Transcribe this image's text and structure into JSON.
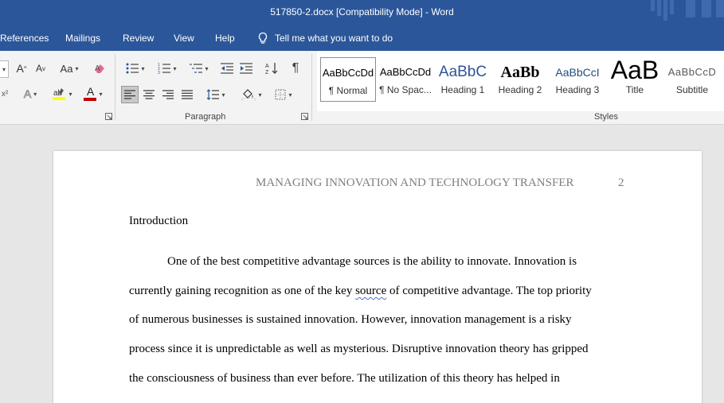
{
  "window": {
    "title": "517850-2.docx [Compatibility Mode]  -  Word"
  },
  "tabs": [
    "References",
    "Mailings",
    "Review",
    "View",
    "Help"
  ],
  "tell_me": {
    "placeholder": "Tell me what you want to do",
    "icon": "lightbulb-icon"
  },
  "ribbon": {
    "groups": {
      "paragraph": "Paragraph",
      "styles": "Styles"
    },
    "font_buttons": {
      "grow_font": "A",
      "shrink_font": "A",
      "change_case": "Aa",
      "text_effects": "A",
      "font_color": "A"
    },
    "colors": {
      "highlight": "#ffff00",
      "font_color": "#c00000",
      "clear_format": "#e06c8c"
    }
  },
  "styles": [
    {
      "sample": "AaBbCcDd",
      "name": "¶ Normal",
      "selected": true
    },
    {
      "sample": "AaBbCcDd",
      "name": "¶ No Spac..."
    },
    {
      "sample": "AaBbC",
      "name": "Heading 1"
    },
    {
      "sample": "AaBb",
      "name": "Heading 2"
    },
    {
      "sample": "AaBbCcI",
      "name": "Heading 3"
    },
    {
      "sample": "AaB",
      "name": "Title"
    },
    {
      "sample": "AaBbCcD",
      "name": "Subtitle"
    }
  ],
  "document": {
    "header": {
      "running_head": "MANAGING INNOVATION AND TECHNOLOGY TRANSFER",
      "page_number": "2"
    },
    "heading": "Introduction",
    "lines": [
      {
        "before": "One of the best competitive advantage sources is the ability to innovate. Innovation is",
        "flagged": "",
        "after": ""
      },
      {
        "before": "currently gaining recognition as one of the key ",
        "flagged": "source",
        "after": " of competitive advantage. The top priority"
      },
      {
        "before": "of numerous businesses is sustained innovation. However, innovation management is a risky",
        "flagged": "",
        "after": ""
      },
      {
        "before": "process since it is unpredictable as well as mysterious. Disruptive innovation theory has gripped",
        "flagged": "",
        "after": ""
      },
      {
        "before": "the consciousness of business than ever before. The utilization of this theory has helped in",
        "flagged": "",
        "after": ""
      }
    ]
  }
}
